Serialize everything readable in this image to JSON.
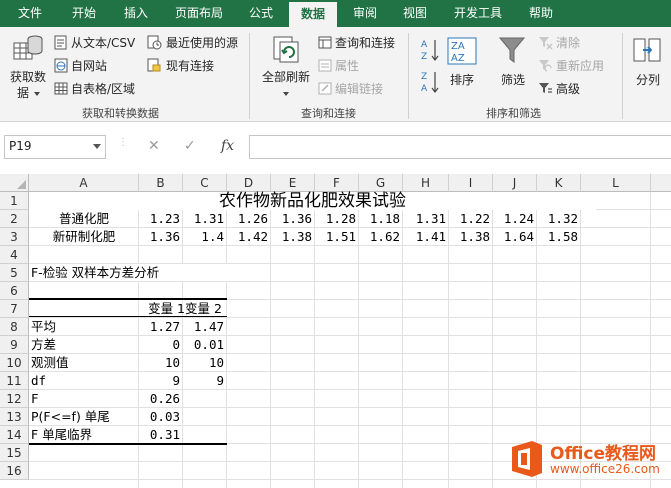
{
  "ribbon_tabs": [
    "文件",
    "开始",
    "插入",
    "页面布局",
    "公式",
    "数据",
    "审阅",
    "视图",
    "开发工具",
    "帮助"
  ],
  "active_tab": "数据",
  "ribbon": {
    "get_data": {
      "line1": "获取数",
      "line2": "据"
    },
    "from_text_csv": "从文本/CSV",
    "from_web": "自网站",
    "from_table": "自表格/区域",
    "recent_sources": "最近使用的源",
    "existing_connections": "现有连接",
    "group_get_transform": "获取和转换数据",
    "refresh_all": "全部刷新",
    "queries_connections": "查询和连接",
    "properties": "属性",
    "edit_links": "编辑链接",
    "group_queries": "查询和连接",
    "sort": "排序",
    "filter": "筛选",
    "clear": "清除",
    "reapply": "重新应用",
    "advanced": "高级",
    "group_sort_filter": "排序和筛选",
    "text_to_columns": "分列"
  },
  "formula_bar": {
    "name_box": "P19",
    "cancel_icon": "✕",
    "enter_icon": "✓",
    "fx_label": "fx",
    "formula": ""
  },
  "columns": [
    "A",
    "B",
    "C",
    "D",
    "E",
    "F",
    "G",
    "H",
    "I",
    "J",
    "K",
    "L"
  ],
  "rows": [
    "1",
    "2",
    "3",
    "4",
    "5",
    "6",
    "7",
    "8",
    "9",
    "10",
    "11",
    "12",
    "13",
    "14",
    "15",
    "16"
  ],
  "sheet": {
    "title": "农作物新品化肥效果试验",
    "row2": {
      "label": "普通化肥",
      "values": [
        "1.23",
        "1.31",
        "1.26",
        "1.36",
        "1.28",
        "1.18",
        "1.31",
        "1.22",
        "1.24",
        "1.32"
      ]
    },
    "row3": {
      "label": "新研制化肥",
      "values": [
        "1.36",
        "1.4",
        "1.42",
        "1.38",
        "1.51",
        "1.62",
        "1.41",
        "1.38",
        "1.64",
        "1.58"
      ]
    },
    "ftest_title": "F-检验 双样本方差分析",
    "var1_header": "变量 1",
    "var2_header": "变量 2",
    "stats": [
      {
        "label": "平均",
        "v1": "1.27",
        "v2": "1.47"
      },
      {
        "label": "方差",
        "v1": "0",
        "v2": "0.01"
      },
      {
        "label": "观测值",
        "v1": "10",
        "v2": "10"
      },
      {
        "label": "df",
        "v1": "9",
        "v2": "9"
      },
      {
        "label": "F",
        "v1": "0.26",
        "v2": ""
      },
      {
        "label": "P(F<=f) 单尾",
        "v1": "0.03",
        "v2": ""
      },
      {
        "label": "F 单尾临界",
        "v1": "0.31",
        "v2": ""
      }
    ]
  },
  "watermark": {
    "name": "Office教程网",
    "url": "www.office26.com"
  }
}
